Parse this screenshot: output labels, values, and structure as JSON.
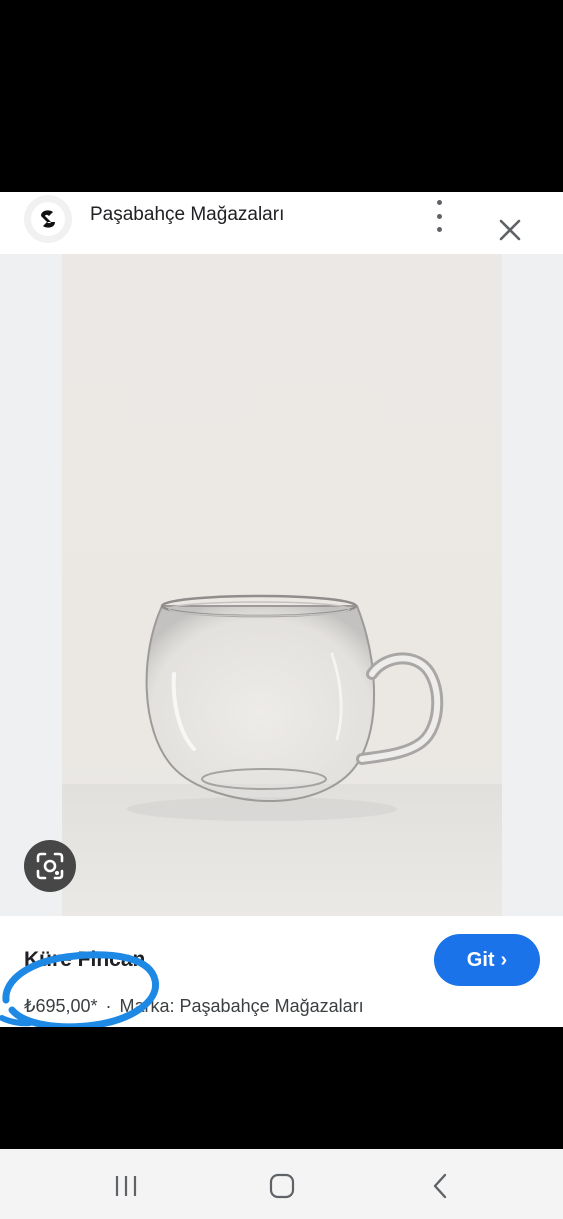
{
  "header": {
    "site_name": "Paşabahçe Mağazaları",
    "logo_icon": "pasabahce-logo-icon",
    "more_icon": "more-vert-icon",
    "close_icon": "close-icon"
  },
  "image": {
    "lens_icon": "google-lens-icon"
  },
  "product": {
    "title": "Küre Fincan",
    "price": "₺695,00*",
    "separator": "·",
    "brand": "Marka: Paşabahçe Mağazaları"
  },
  "actions": {
    "go_label": "Git"
  },
  "colors": {
    "accent": "#1a73e8",
    "scribble": "#1e88e5"
  },
  "navbar": {
    "recents_icon": "recent-apps-icon",
    "home_icon": "home-icon",
    "back_icon": "back-icon"
  }
}
